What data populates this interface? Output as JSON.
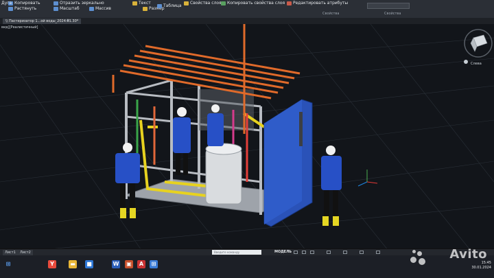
{
  "ribbon": {
    "buttons": [
      {
        "label": "Копировать",
        "icon": "copy-icon"
      },
      {
        "label": "Растянуть",
        "icon": "stretch-icon"
      },
      {
        "label": "Отразить зеркально",
        "icon": "mirror-icon"
      },
      {
        "label": "Масштаб",
        "icon": "scale-icon"
      },
      {
        "label": "Массив",
        "icon": "array-icon"
      },
      {
        "label": "Текст",
        "icon": "text-icon"
      },
      {
        "label": "Размер",
        "icon": "dimension-icon"
      },
      {
        "label": "Таблица",
        "icon": "table-icon"
      },
      {
        "label": "Свойства слоя",
        "icon": "layer-properties-icon"
      },
      {
        "label": "Копировать свойства слоя",
        "icon": "copy-layer-properties-icon"
      },
      {
        "label": "Редактировать атрибуты",
        "icon": "edit-attributes-icon"
      },
      {
        "label": "Дуга",
        "icon": "arc-icon"
      }
    ],
    "group_labels": [
      "Свойства",
      "Свойства"
    ]
  },
  "document_tab": "\\\\ Пастеризатор 1...ой воды_2024.01.30*",
  "viewport_label": "вид][Реалистичный]",
  "viewcube_label": "Слева",
  "statusbar": {
    "layout_tabs": [
      "Лист1",
      "Лист2"
    ],
    "command_placeholder": "Введите команду",
    "model_label": "МОДЕЛЬ"
  },
  "taskbar": {
    "apps": [
      {
        "icon": "yandex-browser-icon",
        "glyph": "Y",
        "color": "#e84a3c"
      },
      {
        "icon": "folder-icon",
        "glyph": "▬",
        "color": "#e9b637"
      },
      {
        "icon": "app-store-icon",
        "glyph": "■",
        "color": "#2f78d6"
      },
      {
        "icon": "word-icon",
        "glyph": "W",
        "color": "#2b5eb8"
      },
      {
        "icon": "powerpoint-icon",
        "glyph": "▣",
        "color": "#c7502c"
      },
      {
        "icon": "autocad-icon",
        "glyph": "A",
        "color": "#c93232"
      },
      {
        "icon": "calculator-icon",
        "glyph": "⊞",
        "color": "#3a7bd5"
      }
    ],
    "time": "15:45",
    "date": "30.01.2024"
  },
  "watermark": "Avito",
  "brand_colors": {
    "cabinet": "#2a52b8",
    "piping": "#e06a2a",
    "frame": "#b8bcc2",
    "worker_suit": "#2750c6"
  }
}
